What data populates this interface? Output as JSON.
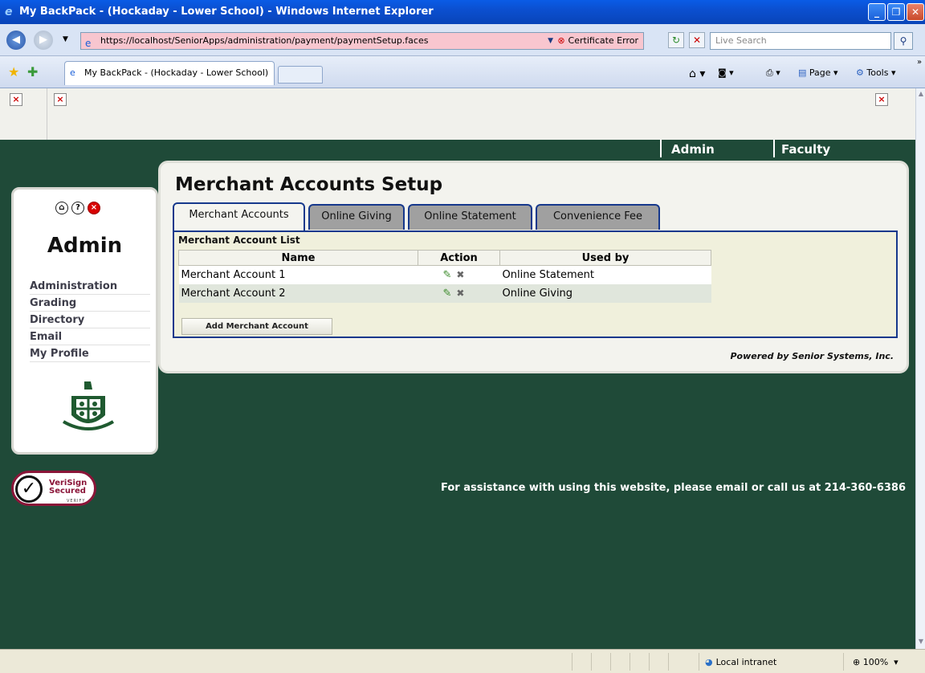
{
  "window": {
    "title": "My BackPack - (Hockaday - Lower School) - Windows Internet Explorer"
  },
  "address_bar": {
    "url": "https://localhost/SeniorApps/administration/payment/paymentSetup.faces",
    "cert_error": "Certificate Error",
    "search_placeholder": "Live Search"
  },
  "browser_tab": {
    "label": "My BackPack - (Hockaday - Lower School)"
  },
  "command_bar": {
    "page_label": "Page",
    "tools_label": "Tools"
  },
  "top_nav": {
    "items": [
      "Admin",
      "Faculty"
    ]
  },
  "left_panel": {
    "title": "Admin",
    "menu": [
      "Administration",
      "Grading",
      "Directory",
      "Email",
      "My Profile"
    ]
  },
  "main": {
    "title": "Merchant Accounts Setup",
    "tabs": [
      {
        "label": "Merchant Accounts",
        "active": true
      },
      {
        "label": "Online Giving",
        "active": false
      },
      {
        "label": "Online Statement",
        "active": false
      },
      {
        "label": "Convenience Fee",
        "active": false
      }
    ],
    "list_title": "Merchant Account List",
    "columns": [
      "Name",
      "Action",
      "Used by"
    ],
    "rows": [
      {
        "name": "Merchant Account 1",
        "used_by": "Online Statement"
      },
      {
        "name": "Merchant Account 2",
        "used_by": "Online Giving"
      }
    ],
    "add_button": "Add Merchant Account",
    "powered_by": "Powered by Senior Systems, Inc."
  },
  "footer": {
    "verisign_line1": "VeriSign",
    "verisign_line2": "Secured",
    "verisign_verify": "VERIFY",
    "assistance": "For assistance with using this website, please email or call us at 214-360-6386"
  },
  "status_bar": {
    "zone": "Local intranet",
    "zoom": "100%"
  },
  "colors": {
    "page_background": "#1f4a38",
    "tab_border": "#16388c",
    "title_bar": "#0b4fd0"
  }
}
